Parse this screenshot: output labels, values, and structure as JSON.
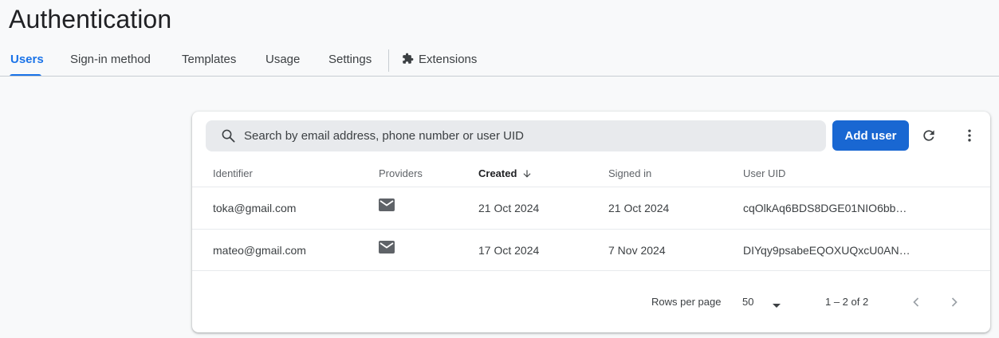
{
  "page": {
    "title": "Authentication"
  },
  "tabs": [
    {
      "label": "Users",
      "active": true
    },
    {
      "label": "Sign-in method"
    },
    {
      "label": "Templates"
    },
    {
      "label": "Usage"
    },
    {
      "label": "Settings"
    },
    {
      "label": "Extensions",
      "icon": "extension-icon"
    }
  ],
  "toolbar": {
    "search_placeholder": "Search by email address, phone number or user UID",
    "add_user_label": "Add user",
    "refresh_icon": "refresh-icon",
    "more_icon": "more-vert-icon"
  },
  "table": {
    "columns": [
      "Identifier",
      "Providers",
      "Created",
      "Signed in",
      "User UID"
    ],
    "sorted_column": "Created",
    "sort_direction": "descending",
    "rows": [
      {
        "identifier": "toka@gmail.com",
        "provider_icon": "email-icon",
        "created": "21 Oct 2024",
        "signed_in": "21 Oct 2024",
        "uid": "cqOlkAq6BDS8DGE01NIO6bb…"
      },
      {
        "identifier": "mateo@gmail.com",
        "provider_icon": "email-icon",
        "created": "17 Oct 2024",
        "signed_in": "7 Nov 2024",
        "uid": "DIYqy9psabeEQOXUQxcU0AN…"
      }
    ]
  },
  "pagination": {
    "rows_per_page_label": "Rows per page",
    "rows_per_page_value": "50",
    "range_label": "1 – 2 of 2"
  },
  "colors": {
    "accent": "#1a73e8",
    "button": "#1967d2",
    "background": "#f8f9fa"
  }
}
